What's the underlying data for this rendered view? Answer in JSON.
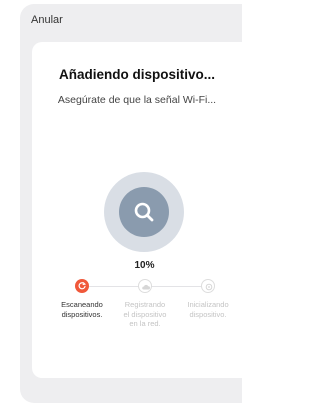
{
  "header": {
    "cancel_label": "Anular"
  },
  "card": {
    "title": "Añadiendo dispositivo...",
    "subtitle": "Asegúrate de que la señal Wi-Fi..."
  },
  "progress": {
    "percent_label": "10%",
    "value": 0.1
  },
  "icons": {
    "center": "search-icon"
  },
  "steps": [
    {
      "label": "Escaneando dispositivos.",
      "state": "active",
      "icon": "refresh-icon"
    },
    {
      "label": "Registrando el dispositivo en la red.",
      "state": "pending",
      "icon": "cloud-icon"
    },
    {
      "label": "Inicializando dispositivo.",
      "state": "pending",
      "icon": "sync-icon"
    }
  ],
  "colors": {
    "accent": "#f0583a",
    "circle_inner": "#8a9bae",
    "circle_outer": "#d9dee5",
    "pending": "#c4c4c4"
  }
}
